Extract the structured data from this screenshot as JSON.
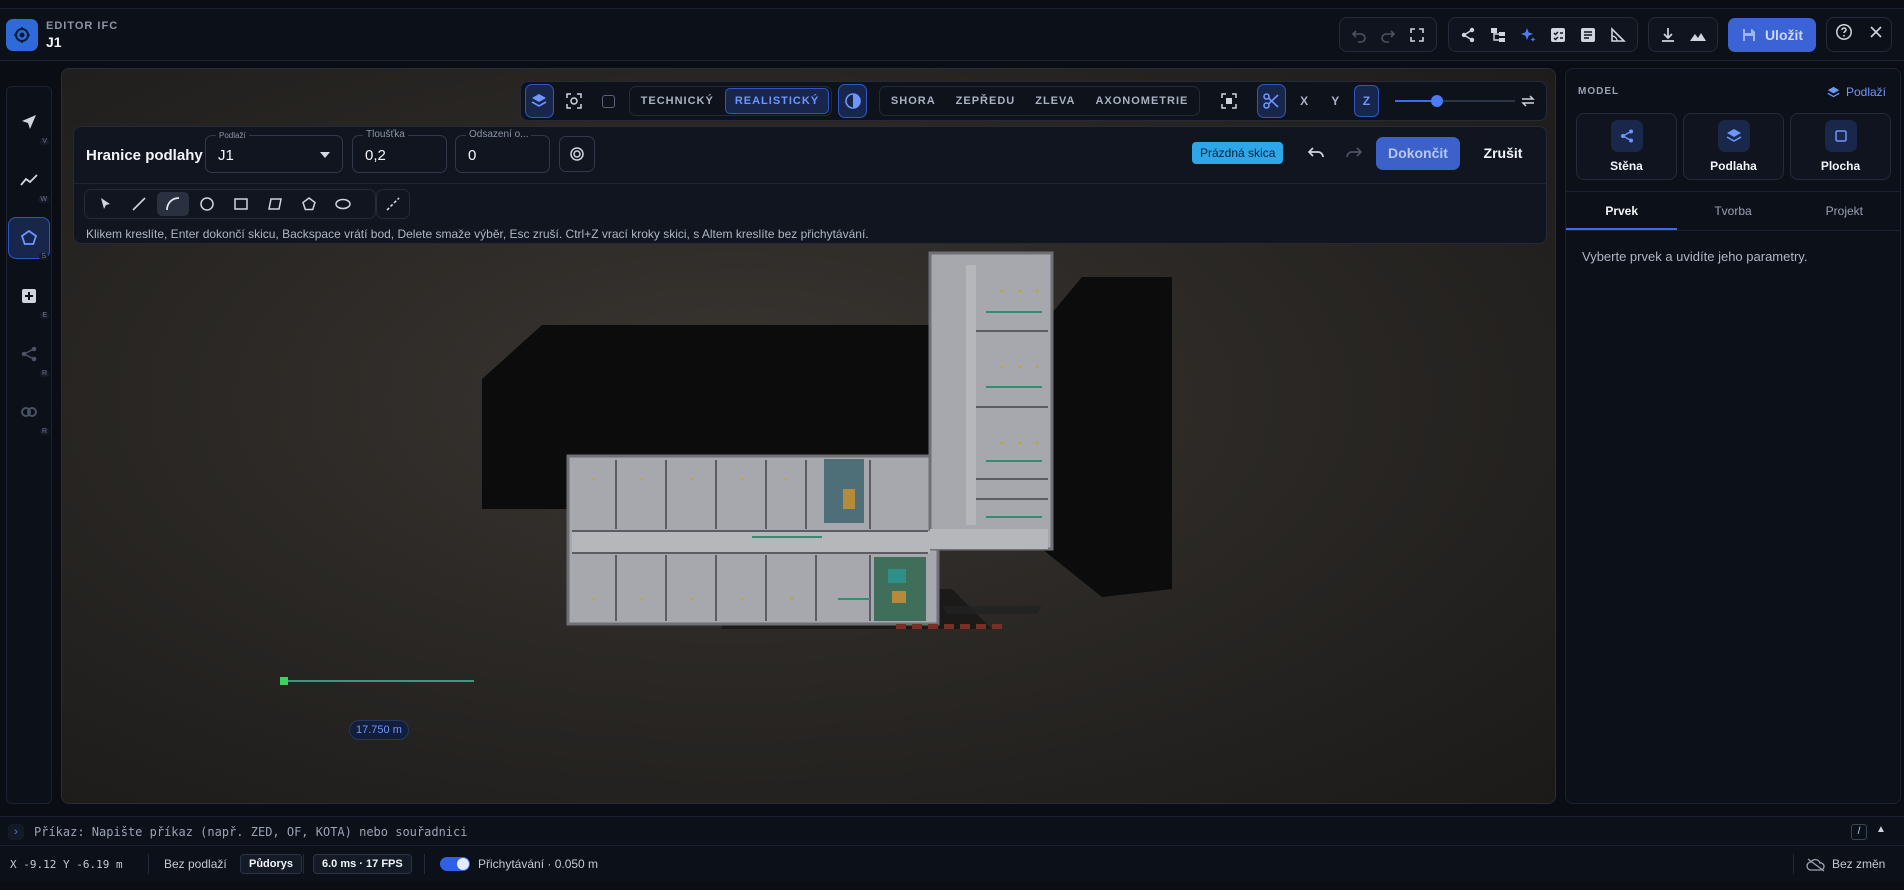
{
  "header": {
    "subtitle": "EDITOR IFC",
    "title": "J1",
    "save_label": "Uložit"
  },
  "left_tools": [
    {
      "name": "select",
      "key": "V"
    },
    {
      "name": "wall",
      "key": "W"
    },
    {
      "name": "polygon",
      "key": "S"
    },
    {
      "name": "add",
      "key": "E"
    },
    {
      "name": "share",
      "key": "R"
    },
    {
      "name": "link",
      "key": "R"
    }
  ],
  "viewbar": {
    "mode_technical": "TECHNICKÝ",
    "mode_realistic": "REALISTICKÝ",
    "view_top": "SHORA",
    "view_front": "ZEPŘEDU",
    "view_left": "ZLEVA",
    "view_axon": "AXONOMETRIE",
    "axis_x": "X",
    "axis_y": "Y",
    "axis_z": "Z",
    "slider_value": 0.35
  },
  "sketch": {
    "title": "Hranice podlahy",
    "level_label": "Podlaží",
    "level_value": "J1",
    "thickness_label": "Tloušťka",
    "thickness_value": "0,2",
    "offset_label": "Odsazení o...",
    "offset_value": "0",
    "status_badge": "Prázdná skica",
    "finish_label": "Dokončit",
    "cancel_label": "Zrušit",
    "hint": "Klikem kreslíte, Enter dokončí skicu, Backspace vrátí bod, Delete smaže výběr, Esc zruší. Ctrl+Z vrací kroky skici, s Altem kreslíte bez přichytávání."
  },
  "canvas": {
    "measure_label": "17.750 m"
  },
  "right_panel": {
    "heading": "MODEL",
    "level_link": "Podlaží",
    "cards": [
      "Stěna",
      "Podlaha",
      "Plocha"
    ],
    "tabs": [
      "Prvek",
      "Tvorba",
      "Projekt"
    ],
    "message": "Vyberte prvek a uvidíte jeho parametry."
  },
  "command": {
    "text": "Příkaz: Napište příkaz (např. ZED, OF, KOTA) nebo souřadnici",
    "key": "/"
  },
  "status": {
    "coords": "X -9.12 Y -6.19 m",
    "level": "Bez podlaží",
    "view": "Půdorys",
    "perf": "6.0 ms · 17 FPS",
    "snap": "Přichytávání · 0.050 m",
    "changes": "Bez změn"
  },
  "colors": {
    "accent": "#3b6bf0",
    "badge": "#2ea6e8"
  }
}
